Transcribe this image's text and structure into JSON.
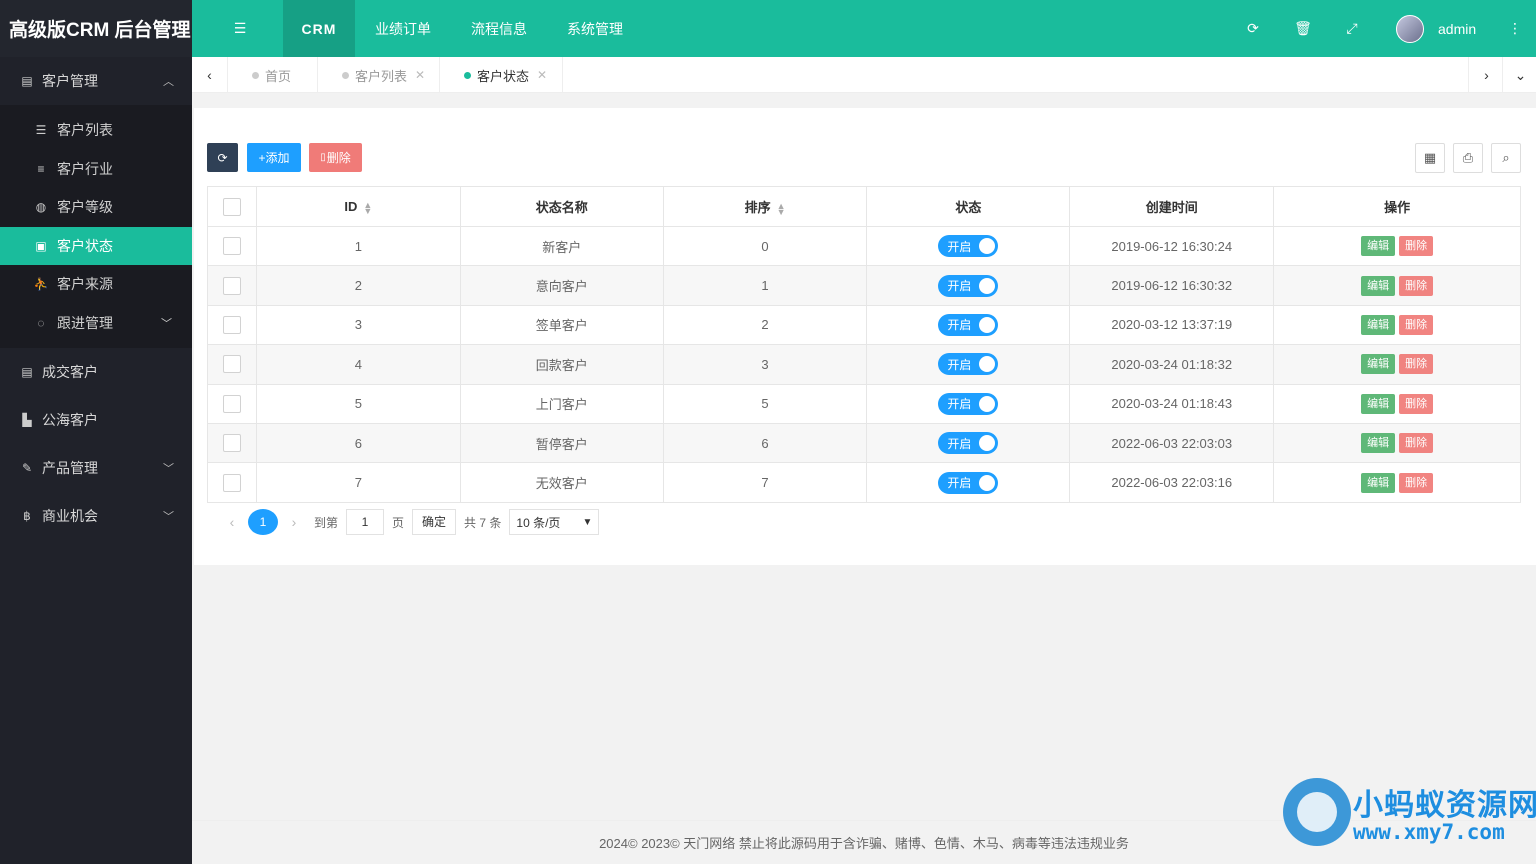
{
  "app": {
    "logo": "高级版CRM 后台管理",
    "brand_color": "#1abc9c"
  },
  "header": {
    "nav": [
      {
        "label": "CRM",
        "active": true
      },
      {
        "label": "业绩订单",
        "active": false
      },
      {
        "label": "流程信息",
        "active": false
      },
      {
        "label": "系统管理",
        "active": false
      }
    ],
    "user": "admin",
    "icons": [
      "menu-toggle-icon",
      "refresh-icon",
      "trash-icon",
      "fullscreen-icon",
      "more-icon"
    ]
  },
  "sidebar": {
    "groups": [
      {
        "label": "客户管理",
        "icon": "id-card-icon",
        "expanded": true
      },
      {
        "label": "成交客户",
        "icon": "id-card-icon"
      },
      {
        "label": "公海客户",
        "icon": "bar-chart-icon"
      },
      {
        "label": "产品管理",
        "icon": "wrench-icon"
      },
      {
        "label": "商业机会",
        "icon": "bitcoin-icon"
      }
    ],
    "sub_items": [
      {
        "label": "客户列表",
        "icon": "list-icon"
      },
      {
        "label": "客户行业",
        "icon": "align-icon"
      },
      {
        "label": "客户等级",
        "icon": "compass-icon"
      },
      {
        "label": "客户状态",
        "icon": "newspaper-icon",
        "active": true
      },
      {
        "label": "客户来源",
        "icon": "walk-icon"
      },
      {
        "label": "跟进管理",
        "icon": "comments-icon"
      }
    ]
  },
  "tabs": [
    {
      "label": "首页",
      "closable": false,
      "active": false
    },
    {
      "label": "客户列表",
      "closable": true,
      "active": false
    },
    {
      "label": "客户状态",
      "closable": true,
      "active": true
    }
  ],
  "toolbar": {
    "add_label": "+添加",
    "delete_label": "删除"
  },
  "table": {
    "columns": [
      "ID",
      "状态名称",
      "排序",
      "状态",
      "创建时间",
      "操作"
    ],
    "rows": [
      {
        "id": "1",
        "name": "新客户",
        "sort": "0",
        "status": "开启",
        "created": "2019-06-12 16:30:24"
      },
      {
        "id": "2",
        "name": "意向客户",
        "sort": "1",
        "status": "开启",
        "created": "2019-06-12 16:30:32"
      },
      {
        "id": "3",
        "name": "签单客户",
        "sort": "2",
        "status": "开启",
        "created": "2020-03-12 13:37:19"
      },
      {
        "id": "4",
        "name": "回款客户",
        "sort": "3",
        "status": "开启",
        "created": "2020-03-24 01:18:32"
      },
      {
        "id": "5",
        "name": "上门客户",
        "sort": "5",
        "status": "开启",
        "created": "2020-03-24 01:18:43"
      },
      {
        "id": "6",
        "name": "暂停客户",
        "sort": "6",
        "status": "开启",
        "created": "2022-06-03 22:03:03"
      },
      {
        "id": "7",
        "name": "无效客户",
        "sort": "7",
        "status": "开启",
        "created": "2022-06-03 22:03:16"
      }
    ],
    "edit_label": "编辑",
    "delete_label": "删除"
  },
  "pager": {
    "current": "1",
    "goto_label": "到第",
    "page_input": "1",
    "page_unit": "页",
    "confirm": "确定",
    "total": "共 7 条",
    "page_size": "10 条/页"
  },
  "footer": {
    "text": "2024© 2023© 天门网络 禁止将此源码用于含诈骗、赌博、色情、木马、病毒等违法违规业务"
  },
  "watermark": {
    "line1": "小蚂蚁资源网",
    "line2": "www.xmy7.com"
  }
}
